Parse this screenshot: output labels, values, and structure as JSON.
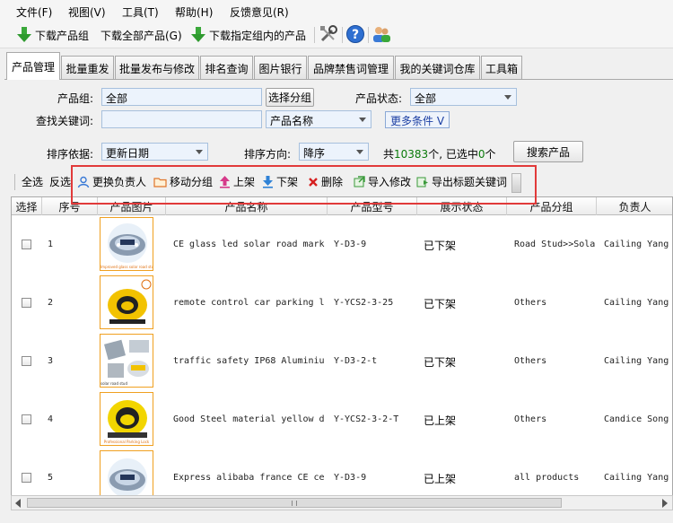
{
  "menu": [
    "文件(F)",
    "视图(V)",
    "工具(T)",
    "帮助(H)",
    "反馈意见(R)"
  ],
  "toolbar": {
    "download_group": "下载产品组",
    "download_all": "下载全部产品(G)",
    "download_selected": "下载指定组内的产品"
  },
  "tabs": [
    "产品管理",
    "批量重发",
    "批量发布与修改",
    "排名查询",
    "图片银行",
    "品牌禁售词管理",
    "我的关键词仓库",
    "工具箱"
  ],
  "filters": {
    "group_label": "产品组:",
    "group_value": "全部",
    "select_group": "选择分组",
    "status_label": "产品状态:",
    "status_value": "全部",
    "keyword_label": "查找关键词:",
    "keyword_value": "",
    "field_value": "产品名称",
    "more_conditions": "更多条件 V",
    "sort_label": "排序依据:",
    "sort_value": "更新日期",
    "direction_label": "排序方向:",
    "direction_value": "降序",
    "count_prefix": "共",
    "total": "10383",
    "count_mid": "个, 已选中",
    "selected": "0",
    "count_suffix": "个",
    "search_button": "搜索产品"
  },
  "actions": {
    "select_all": "全选",
    "invert": "反选",
    "change_owner": "更换负责人",
    "move_group": "移动分组",
    "online": "上架",
    "offline": "下架",
    "delete": "删除",
    "import_edit": "导入修改",
    "export_keywords": "导出标题关键词"
  },
  "columns": [
    "选择",
    "序号",
    "产品图片",
    "产品名称",
    "产品型号",
    "展示状态",
    "产品分组",
    "负责人"
  ],
  "rows": [
    {
      "no": "1",
      "name": "CE glass led solar road mark",
      "model": "Y-D3-9",
      "status": "已下架",
      "group": "Road Stud>>Sola",
      "owner": "Cailing Yang"
    },
    {
      "no": "2",
      "name": "remote control car parking l",
      "model": "Y-YCS2-3-25",
      "status": "已下架",
      "group": "Others",
      "owner": "Cailing Yang"
    },
    {
      "no": "3",
      "name": "traffic safety IP68 Aluminiu",
      "model": "Y-D3-2-t",
      "status": "已下架",
      "group": "Others",
      "owner": "Cailing Yang"
    },
    {
      "no": "4",
      "name": "Good Steel material yellow d",
      "model": "Y-YCS2-3-2-T",
      "status": "已上架",
      "group": "Others",
      "owner": "Candice Song"
    },
    {
      "no": "5",
      "name": "Express alibaba france CE ce",
      "model": "Y-D3-9",
      "status": "已上架",
      "group": "all products",
      "owner": "Cailing Yang"
    }
  ],
  "thumb_banners": [
    "Improved glass solar road stud",
    "",
    "solar road stud",
    "Professional Parking Lock",
    ""
  ],
  "colors": {
    "accent_green": "#0a7a0a",
    "highlight_red": "#e13a3a",
    "input_bg": "#ecf3fc"
  }
}
